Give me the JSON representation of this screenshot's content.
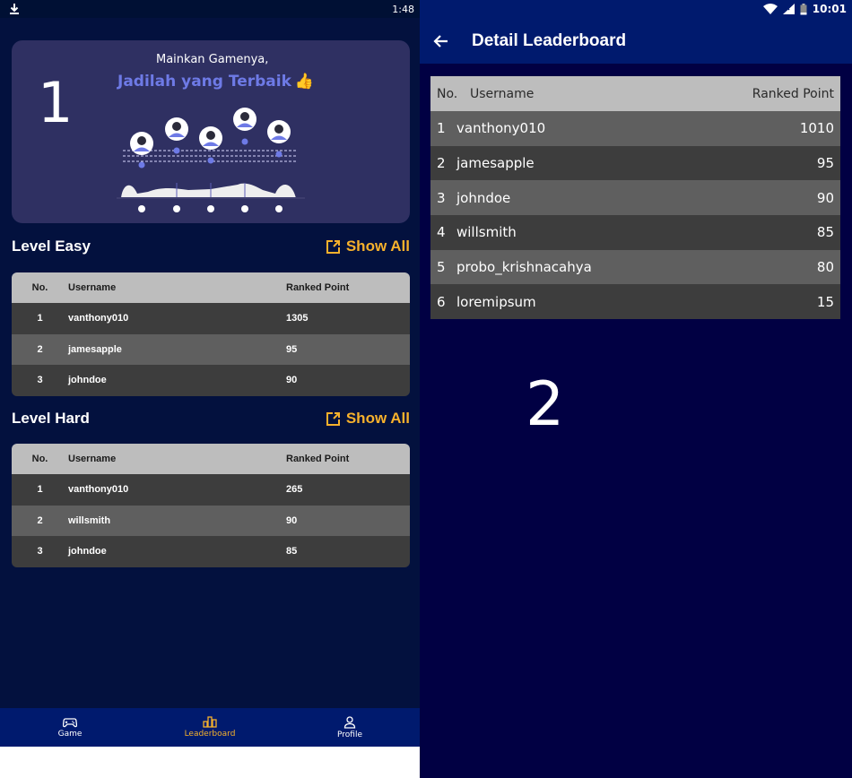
{
  "left": {
    "status_bar": {
      "time": "1:48",
      "download_icon": "download-icon"
    },
    "overlay_label": "1",
    "banner": {
      "subtitle": "Mainkan Gamenya,",
      "title": "Jadilah yang Terbaik",
      "thumb": "👍"
    },
    "sections": [
      {
        "title": "Level Easy",
        "show_all": "Show All",
        "headers": {
          "no": "No.",
          "username": "Username",
          "points": "Ranked Point"
        },
        "rows": [
          {
            "no": "1",
            "username": "vanthony010",
            "points": "1305"
          },
          {
            "no": "2",
            "username": "jamesapple",
            "points": "95"
          },
          {
            "no": "3",
            "username": "johndoe",
            "points": "90"
          }
        ]
      },
      {
        "title": "Level Hard",
        "show_all": "Show All",
        "headers": {
          "no": "No.",
          "username": "Username",
          "points": "Ranked Point"
        },
        "rows": [
          {
            "no": "1",
            "username": "vanthony010",
            "points": "265"
          },
          {
            "no": "2",
            "username": "willsmith",
            "points": "90"
          },
          {
            "no": "3",
            "username": "johndoe",
            "points": "85"
          }
        ]
      }
    ],
    "nav": [
      {
        "label": "Game",
        "icon": "gamepad-icon",
        "active": false
      },
      {
        "label": "Leaderboard",
        "icon": "podium-icon",
        "active": true
      },
      {
        "label": "Profile",
        "icon": "person-icon",
        "active": false
      }
    ]
  },
  "right": {
    "status_bar": {
      "time": "10:01"
    },
    "appbar": {
      "title": "Detail Leaderboard"
    },
    "headers": {
      "no": "No.",
      "username": "Username",
      "points": "Ranked Point"
    },
    "rows": [
      {
        "no": "1",
        "username": "vanthony010",
        "points": "1010"
      },
      {
        "no": "2",
        "username": "jamesapple",
        "points": "95"
      },
      {
        "no": "3",
        "username": "johndoe",
        "points": "90"
      },
      {
        "no": "4",
        "username": "willsmith",
        "points": "85"
      },
      {
        "no": "5",
        "username": "probo_krishnacahya",
        "points": "80"
      },
      {
        "no": "6",
        "username": "loremipsum",
        "points": "15"
      }
    ],
    "overlay_label": "2"
  },
  "colors": {
    "accent": "#f6b12c",
    "banner_title": "#6e7ae6",
    "navy": "#001a6e",
    "page_bg": "#03113e"
  }
}
